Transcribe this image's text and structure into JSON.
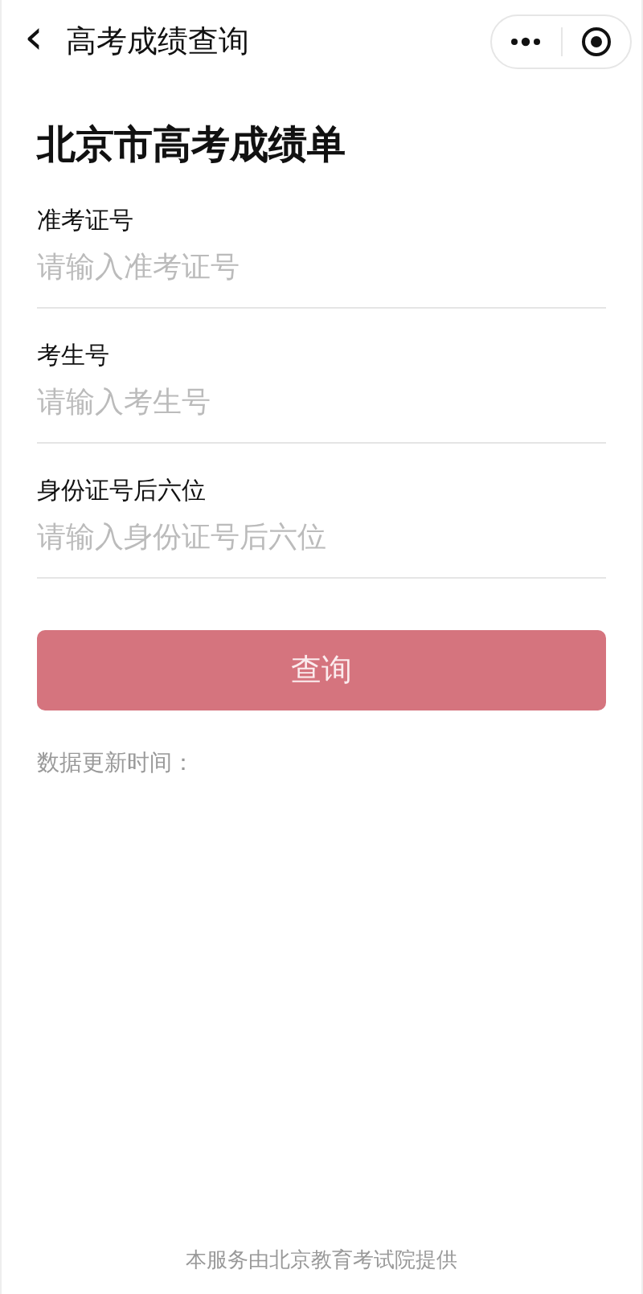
{
  "nav_bar": {
    "back_icon": "‹",
    "title": "高考成绩查询"
  },
  "page_title": "北京市高考成绩单",
  "fields": [
    {
      "label": "准考证号",
      "placeholder": "请输入准考证号"
    },
    {
      "label": "考生号",
      "placeholder": "请输入考生号"
    },
    {
      "label": "身份证号后六位",
      "placeholder": "请输入身份证号后六位"
    }
  ],
  "query_button": {
    "label": "查询",
    "disabled": true
  },
  "update_time": "数据更新时间：",
  "footer": "本服务由北京教育考试院提供"
}
